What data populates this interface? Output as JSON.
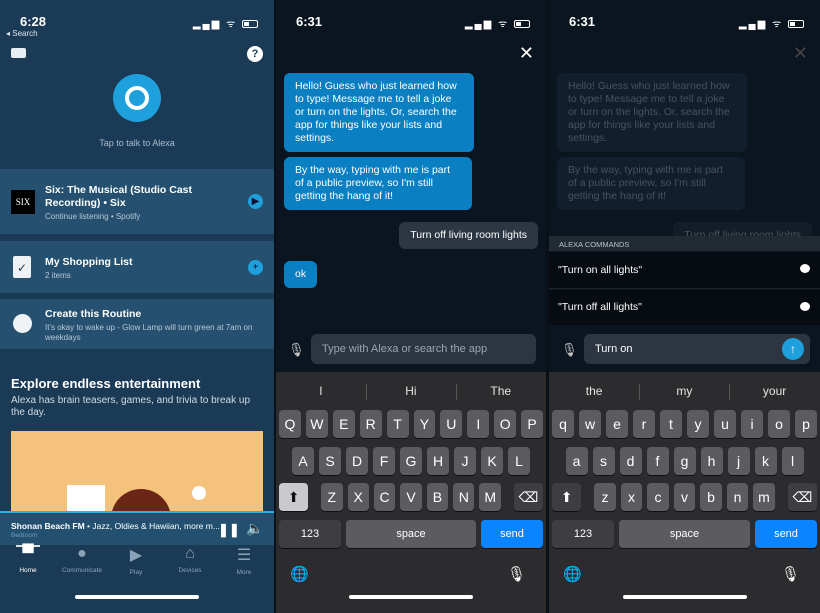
{
  "home": {
    "time": "6:28",
    "back": "◂ Search",
    "status": "▂▄▆ ᯤ",
    "tap_text": "Tap to talk to Alexa",
    "music": {
      "title": "Six: The Musical (Studio Cast Recording) • Six",
      "subtitle": "Continue listening • Spotify",
      "art": "SIX"
    },
    "shopping": {
      "title": "My Shopping List",
      "subtitle": "2 items"
    },
    "routine": {
      "title": "Create this Routine",
      "subtitle": "It's okay to wake up - Glow Lamp will turn green at 7am on weekdays"
    },
    "explore": {
      "title": "Explore endless entertainment",
      "subtitle": "Alexa has brain teasers, games, and trivia to break up the day."
    },
    "player": {
      "title": "Shonan Beach FM",
      "detail": " • Jazz, Oldies & Hawiian, more m...",
      "device": "Bedroom"
    },
    "nav": [
      {
        "label": "Home",
        "icon": "home-icon",
        "glyph": "▀"
      },
      {
        "label": "Communicate",
        "icon": "chat-icon",
        "glyph": "●"
      },
      {
        "label": "Play",
        "icon": "play-icon",
        "glyph": "▶"
      },
      {
        "label": "Devices",
        "icon": "devices-icon",
        "glyph": "⌂"
      },
      {
        "label": "More",
        "icon": "more-icon",
        "glyph": "☰"
      }
    ],
    "accent": "#1ea0dc"
  },
  "chat": {
    "time": "6:31",
    "status": "▂▄▆ ᯤ",
    "messages": [
      {
        "from": "alexa",
        "text": "Hello! Guess who just learned how to type! Message me to tell a joke or turn on the lights. Or, search the app for things like your lists and settings."
      },
      {
        "from": "alexa",
        "text": "By the way, typing with me is part of a public preview, so I'm still getting the hang of it!"
      },
      {
        "from": "user",
        "text": "Turn off living room lights"
      },
      {
        "from": "alexa",
        "text": "ok"
      }
    ],
    "placeholder": "Type with Alexa or search the app",
    "suggestions": [
      "I",
      "Hi",
      "The"
    ]
  },
  "chat2": {
    "time": "6:31",
    "commands_header": "ALEXA COMMANDS",
    "commands": [
      "\"Turn on all lights\"",
      "\"Turn off all lights\""
    ],
    "input_value": "Turn on",
    "suggestions": [
      "the",
      "my",
      "your"
    ]
  },
  "keyboard": {
    "rows": [
      [
        "Q",
        "W",
        "E",
        "R",
        "T",
        "Y",
        "U",
        "I",
        "O",
        "P"
      ],
      [
        "A",
        "S",
        "D",
        "F",
        "G",
        "H",
        "J",
        "K",
        "L"
      ],
      [
        "Z",
        "X",
        "C",
        "V",
        "B",
        "N",
        "M"
      ]
    ],
    "rows_lower": [
      [
        "q",
        "w",
        "e",
        "r",
        "t",
        "y",
        "u",
        "i",
        "o",
        "p"
      ],
      [
        "a",
        "s",
        "d",
        "f",
        "g",
        "h",
        "j",
        "k",
        "l"
      ],
      [
        "z",
        "x",
        "c",
        "v",
        "b",
        "n",
        "m"
      ]
    ],
    "numbers": "123",
    "space": "space",
    "send": "send",
    "shift": "⬆",
    "delete": "⌫",
    "globe": "🌐",
    "dictation": "🎙"
  }
}
